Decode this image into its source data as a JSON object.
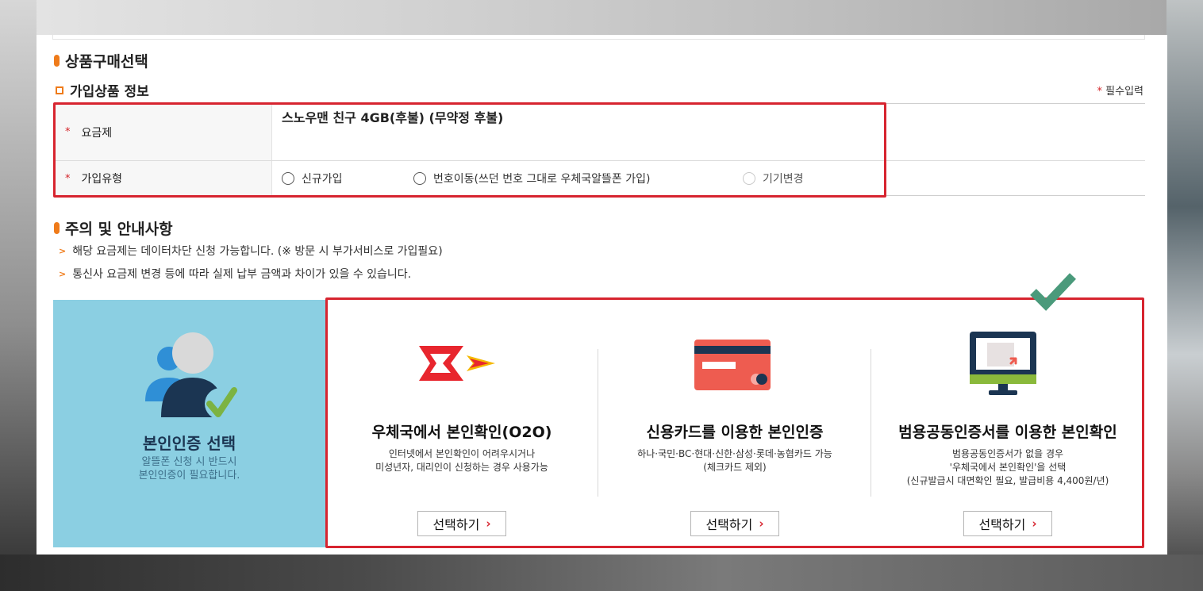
{
  "section1": {
    "title": "상품구매선택"
  },
  "product_info": {
    "subtitle": "가입상품 정보",
    "required_note": "필수입력",
    "required_mark": "*",
    "plan_label": "요금제",
    "plan_value": "스노우맨 친구 4GB(후불) (무약정 후불)",
    "join_type_label": "가입유형",
    "join_types": [
      "신규가입",
      "번호이동(쓰던 번호 그대로 우체국알뜰폰 가입)",
      "기기변경"
    ]
  },
  "section2": {
    "title": "주의 및 안내사항",
    "notices": [
      "해당 요금제는 데이터차단 신청 가능합니다. (※ 방문 시 부가서비스로 가입필요)",
      "통신사 요금제 변경 등에 따라 실제 납부 금액과 차이가 있을 수 있습니다."
    ]
  },
  "auth": {
    "title": "본인인증 선택",
    "desc_lines": [
      "알뜰폰 신청 시 반드시",
      "본인인증이 필요합니다."
    ],
    "options": [
      {
        "title": "우체국에서 본인확인(O2O)",
        "desc_lines": [
          "인터넷에서 본인확인이 어려우시거나",
          "미성년자, 대리인이 신청하는 경우 사용가능"
        ],
        "button": "선택하기"
      },
      {
        "title": "신용카드를 이용한 본인인증",
        "desc_lines": [
          "하나·국민·BC·현대·신한·삼성·롯데·농협카드 가능",
          "(체크카드 제외)"
        ],
        "button": "선택하기"
      },
      {
        "title": "범용공동인증서를 이용한 본인확인",
        "desc_lines": [
          "범용공동인증서가 없을 경우",
          "'우체국에서 본인확인'을 선택",
          "(신규발급시 대면확인 필요, 발급비용 4,400원/년)"
        ],
        "button": "선택하기"
      }
    ]
  },
  "colors": {
    "accent_orange": "#ef7b1a",
    "highlight_red": "#d7242f",
    "auth_blue": "#8bcfe2",
    "check_green": "#4a9a7b"
  },
  "icons": [
    "post-office-logo-icon",
    "credit-card-icon",
    "certificate-monitor-icon",
    "user-verify-icon",
    "checkmark-icon",
    "chevron-right-icon"
  ]
}
